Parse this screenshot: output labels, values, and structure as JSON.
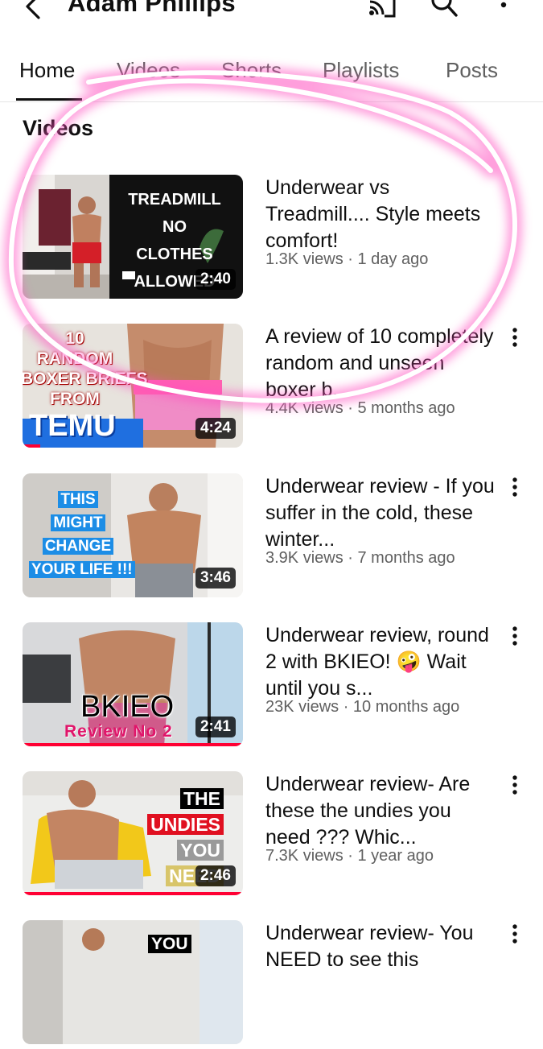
{
  "header": {
    "channel_name": "Adam Phillips",
    "icons": [
      "back-arrow-icon",
      "cast-icon",
      "search-icon",
      "more-vert-icon"
    ]
  },
  "tabs": [
    {
      "label": "Home",
      "active": true
    },
    {
      "label": "Videos",
      "active": false
    },
    {
      "label": "Shorts",
      "active": false
    },
    {
      "label": "Playlists",
      "active": false
    },
    {
      "label": "Posts",
      "active": false
    }
  ],
  "section": {
    "title": "Videos"
  },
  "videos": [
    {
      "title": "Underwear vs Treadmill.... Style meets comfort!",
      "meta": "1.3K views · 1 day ago",
      "duration": "2:40",
      "thumb_text": [
        "TREADMILL",
        "NO",
        "CLOTHES",
        "ALLOWED"
      ],
      "watched_fraction": 0.0
    },
    {
      "title": "A review of 10 completely random and unseen boxer b...",
      "meta": "4.4K views · 5 months ago",
      "duration": "4:24",
      "thumb_text": [
        "10",
        "RANDOM",
        "BOXER BRIEFS",
        "FROM",
        "TEMU"
      ],
      "watched_fraction": 0.08
    },
    {
      "title": "Underwear review - If you suffer in the cold, these winter...",
      "meta": "3.9K views · 7 months ago",
      "duration": "3:46",
      "thumb_text": [
        "THIS",
        "MIGHT",
        "CHANGE",
        "YOUR LIFE !!!"
      ],
      "watched_fraction": 0.0
    },
    {
      "title": "Underwear review, round 2 with BKIEO! 🤪 Wait until you s...",
      "meta": "23K views · 10 months ago",
      "duration": "2:41",
      "thumb_text": [
        "BKIEO",
        "Review No 2"
      ],
      "watched_fraction": 1.0
    },
    {
      "title": "Underwear review- Are these the undies you need ???  Whic...",
      "meta": "7.3K views · 1 year ago",
      "duration": "2:46",
      "thumb_text": [
        "THE",
        "UNDIES",
        "YOU",
        "NEED"
      ],
      "watched_fraction": 1.0
    },
    {
      "title": "Underwear review- You NEED to see this",
      "meta": "",
      "duration": "",
      "thumb_text": [
        "YOU"
      ],
      "watched_fraction": 0.0
    }
  ],
  "colors": {
    "accent": "#ff0033",
    "highlight": "#ff2fae",
    "text": "#0f0f0f",
    "muted": "#606060"
  }
}
